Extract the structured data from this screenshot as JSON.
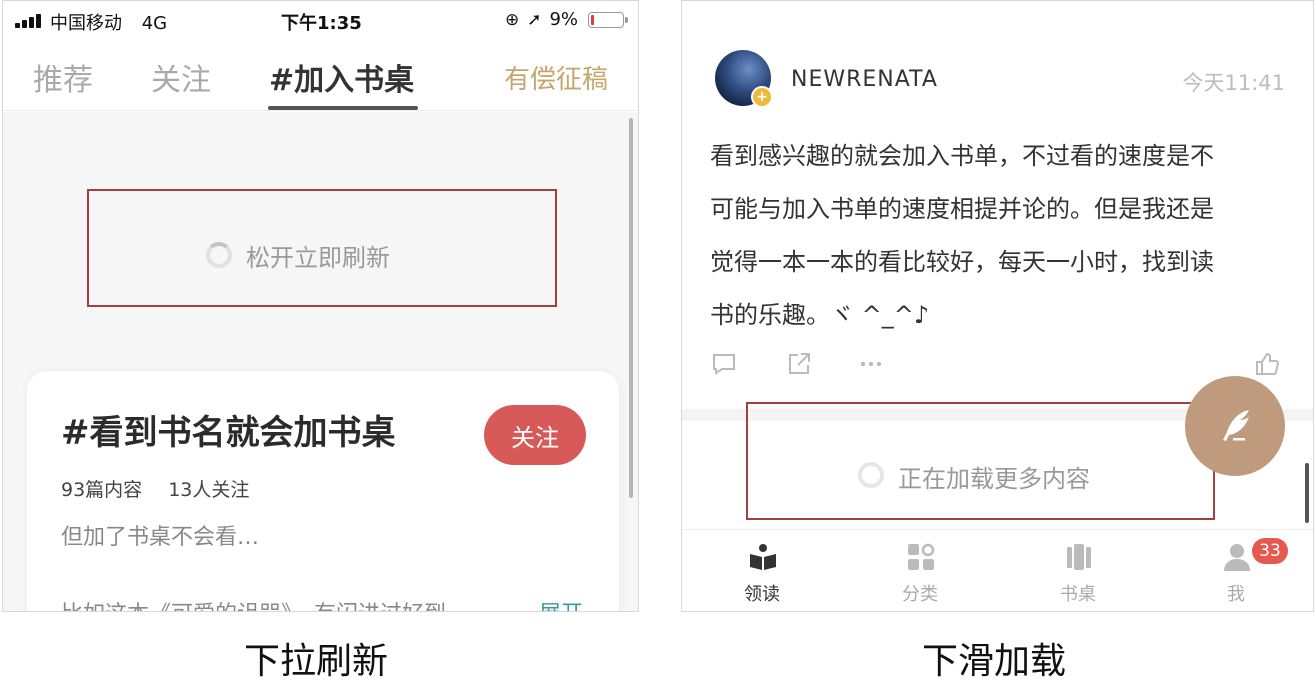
{
  "left_panel": {
    "status_bar": {
      "carrier": "中国移动",
      "network": "4G",
      "time": "下午1:35",
      "battery_percent": "9%",
      "battery_level": 0.09,
      "icons": [
        "rotation-lock-icon",
        "location-arrow-icon"
      ]
    },
    "tabs": [
      {
        "label": "推荐",
        "active": false
      },
      {
        "label": "关注",
        "active": false
      },
      {
        "label": "#加入书桌",
        "active": true
      }
    ],
    "paid_submission": "有偿征稿",
    "refresh_text": "松开立即刷新",
    "topic_card": {
      "title": "#看到书名就会加书桌",
      "follow_label": "关注",
      "posts_count": "93篇内容",
      "followers_count": "13人关注",
      "description": "但加了书桌不会看…",
      "preview": "比如这本《可爱的诅咒》，有闪进过好到",
      "expand_label": "展开"
    },
    "accent_color": "#d75a58"
  },
  "right_panel": {
    "post": {
      "username": "NEWRENATA",
      "time": "今天11:41",
      "body_lines": [
        "看到感兴趣的就会加入书单，不过看的速度是不",
        "可能与加入书单的速度相提并论的。但是我还是",
        "觉得一本一本的看比较好，每天一小时，找到读",
        "书的乐趣。ヾ ^_^♪"
      ],
      "action_icons": [
        "comment-icon",
        "share-icon",
        "more-icon",
        "like-icon"
      ]
    },
    "loading_text": "正在加载更多内容",
    "fab_icon": "feather-pen-icon",
    "bottom_nav": [
      {
        "label": "领读",
        "icon": "book-icon",
        "active": true
      },
      {
        "label": "分类",
        "icon": "category-icon",
        "active": false
      },
      {
        "label": "书桌",
        "icon": "bookshelf-icon",
        "active": false
      },
      {
        "label": "我",
        "icon": "person-icon",
        "active": false,
        "badge": "33"
      }
    ],
    "fab_color": "#c09a7d"
  },
  "captions": {
    "left": "下拉刷新",
    "right": "下滑加载"
  }
}
